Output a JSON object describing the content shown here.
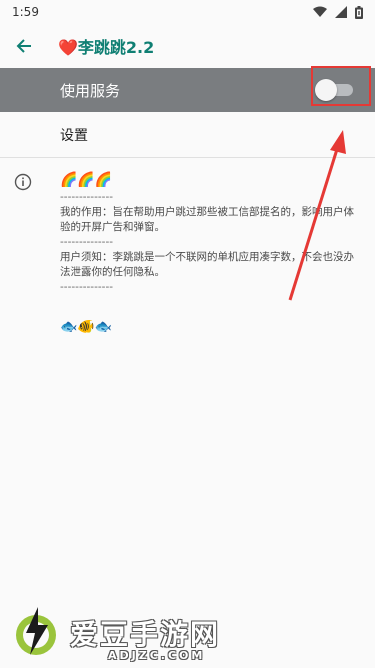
{
  "status_bar": {
    "time": "1:59"
  },
  "app_bar": {
    "title": "❤️李跳跳2.2"
  },
  "service_row": {
    "label": "使用服务",
    "toggle_on": false
  },
  "settings_row": {
    "label": "设置"
  },
  "info": {
    "emoji_top": "🌈🌈🌈",
    "sep": "--------------",
    "purpose": "我的作用：旨在帮助用户跳过那些被工信部提名的，影响用户体验的开屏广告和弹窗。",
    "notice": "用户须知：李跳跳是一个不联网的单机应用凑字数，不会也没办法泄露你的任何隐私。",
    "emoji_bottom": "🐟🐠🐟"
  },
  "watermark": {
    "name": "爱豆手游网",
    "domain": "ADJZC.COM"
  },
  "colors": {
    "accent": "#0f7f73",
    "service_bg": "#7a7d80",
    "highlight": "#e53935"
  }
}
